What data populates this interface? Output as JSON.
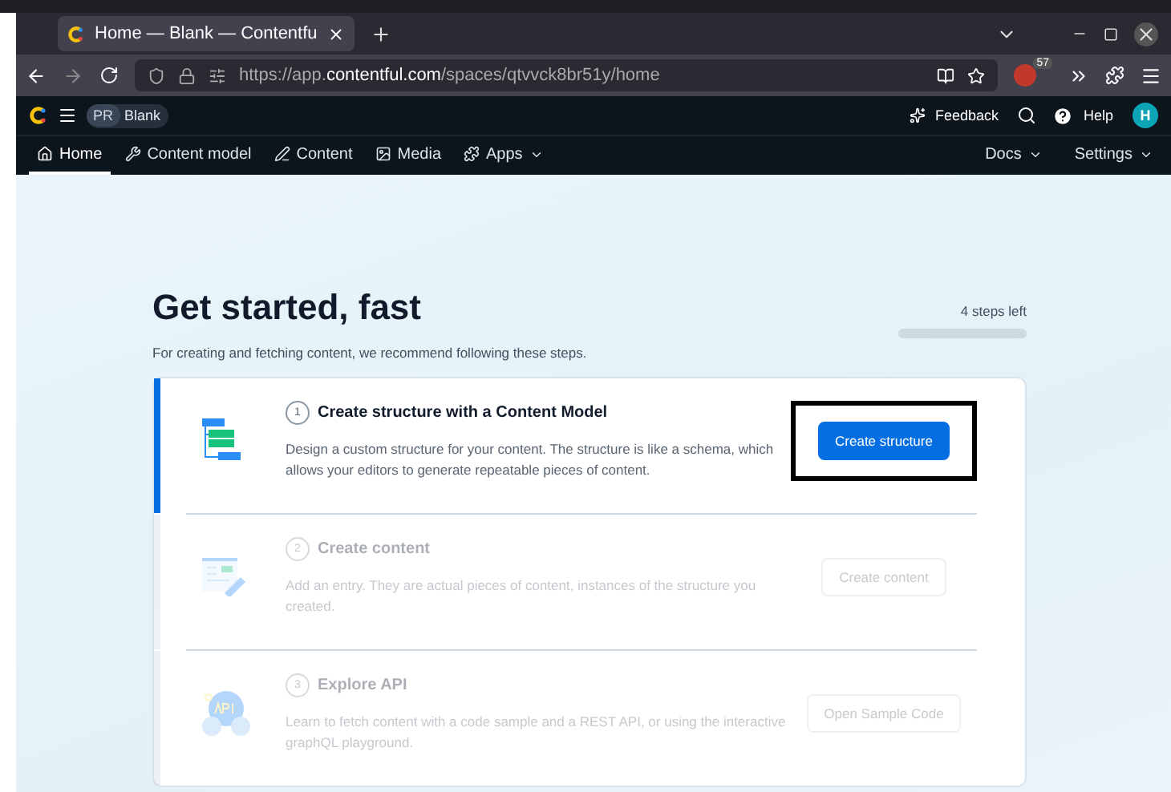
{
  "browser": {
    "tab": {
      "title": "Home — Blank — Contentfu",
      "selected": true
    },
    "url": {
      "prefix": "https://app.",
      "host": "contentful.com",
      "path": "/spaces/qtvvck8br51y/home"
    },
    "extension_badge": "57"
  },
  "app_header": {
    "space_initials": "PR",
    "space_name": "Blank",
    "feedback": "Feedback",
    "help": "Help",
    "avatar": "H"
  },
  "nav": {
    "items": [
      {
        "label": "Home",
        "selected": true,
        "kind": "plain"
      },
      {
        "label": "Content model",
        "selected": false,
        "kind": "plain"
      },
      {
        "label": "Content",
        "selected": false,
        "kind": "plain"
      },
      {
        "label": "Media",
        "selected": false,
        "kind": "plain"
      },
      {
        "label": "Apps",
        "selected": false,
        "kind": "menu"
      }
    ],
    "right": [
      {
        "label": "Docs"
      },
      {
        "label": "Settings"
      }
    ]
  },
  "page": {
    "title": "Get started, fast",
    "subtitle": "For creating and fetching content, we recommend following these steps.",
    "steps_left": "4 steps left",
    "progress": {
      "level": 0
    },
    "steps": [
      {
        "number": "1",
        "title": "Create structure with a Content Model",
        "description": "Design a custom structure for your content. The structure is like a schema, which allows your editors to generate repeatable pieces of content.",
        "button": "Create structure",
        "active": true,
        "highlighted": true,
        "kind": "model"
      },
      {
        "number": "2",
        "title": "Create content",
        "description": "Add an entry. They are actual pieces of content, instances of the structure you created.",
        "button": "Create content",
        "active": false,
        "highlighted": false,
        "kind": "entry"
      },
      {
        "number": "3",
        "title": "Explore API",
        "description": "Learn to fetch content with a code sample and a REST API, or using the interactive graphQL playground.",
        "button": "Open Sample Code",
        "active": false,
        "highlighted": false,
        "kind": "api"
      }
    ]
  }
}
